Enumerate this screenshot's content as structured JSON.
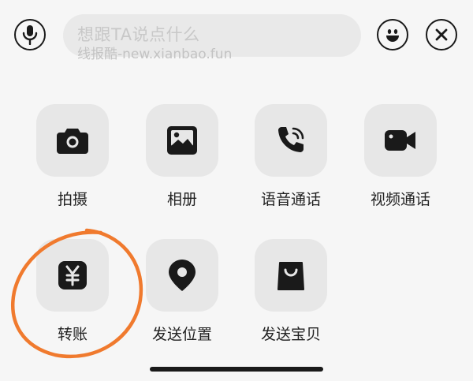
{
  "top_bar": {
    "voice_icon": "microphone-icon",
    "input_placeholder": "想跟TA说点什么",
    "watermark": "线报酷-new.xianbao.fun",
    "emoji_icon": "smiley-icon",
    "close_icon": "close-icon"
  },
  "actions": [
    {
      "label": "拍摄",
      "icon": "camera-icon"
    },
    {
      "label": "相册",
      "icon": "photo-album-icon"
    },
    {
      "label": "语音通话",
      "icon": "phone-call-icon"
    },
    {
      "label": "视频通话",
      "icon": "video-camera-icon"
    },
    {
      "label": "转账",
      "icon": "yuan-transfer-icon"
    },
    {
      "label": "发送位置",
      "icon": "location-pin-icon"
    },
    {
      "label": "发送宝贝",
      "icon": "shopping-bag-icon"
    }
  ],
  "annotation_color": "#f07a2e",
  "tile_color": "#e7e7e7",
  "icon_color": "#1a1a1a"
}
